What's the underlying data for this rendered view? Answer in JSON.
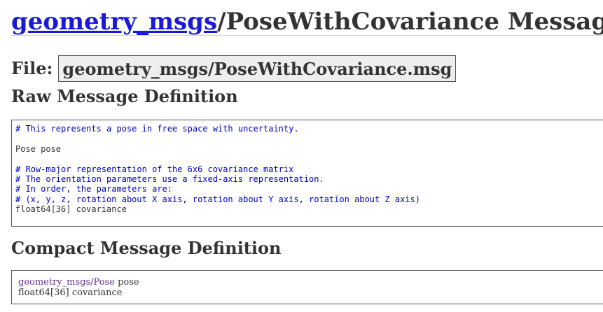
{
  "header": {
    "package_link": "geometry_msgs",
    "title_rest": "/PoseWithCovariance Message"
  },
  "file": {
    "label": "File:",
    "filename": "geometry_msgs/PoseWithCovariance.msg"
  },
  "raw_definition": {
    "heading": "Raw Message Definition",
    "lines": [
      {
        "text": "# This represents a pose in free space with uncertainty.",
        "kind": "comment"
      },
      {
        "text": "",
        "kind": "plain"
      },
      {
        "text": "Pose pose",
        "kind": "plain"
      },
      {
        "text": "",
        "kind": "plain"
      },
      {
        "text": "# Row-major representation of the 6x6 covariance matrix",
        "kind": "comment"
      },
      {
        "text": "# The orientation parameters use a fixed-axis representation.",
        "kind": "comment"
      },
      {
        "text": "# In order, the parameters are:",
        "kind": "comment"
      },
      {
        "text": "# (x, y, z, rotation about X axis, rotation about Y axis, rotation about Z axis)",
        "kind": "comment"
      },
      {
        "text": "float64[36] covariance",
        "kind": "plain"
      }
    ]
  },
  "compact_definition": {
    "heading": "Compact Message Definition",
    "line1_type": "geometry_msgs/Pose",
    "line1_name": " pose",
    "line2": "float64[36] covariance"
  },
  "colors": {
    "link": "#1a1ad6",
    "comment": "#0000cc",
    "type_link": "#663399",
    "text": "#333333",
    "file_box_bg": "#eeeeee"
  }
}
